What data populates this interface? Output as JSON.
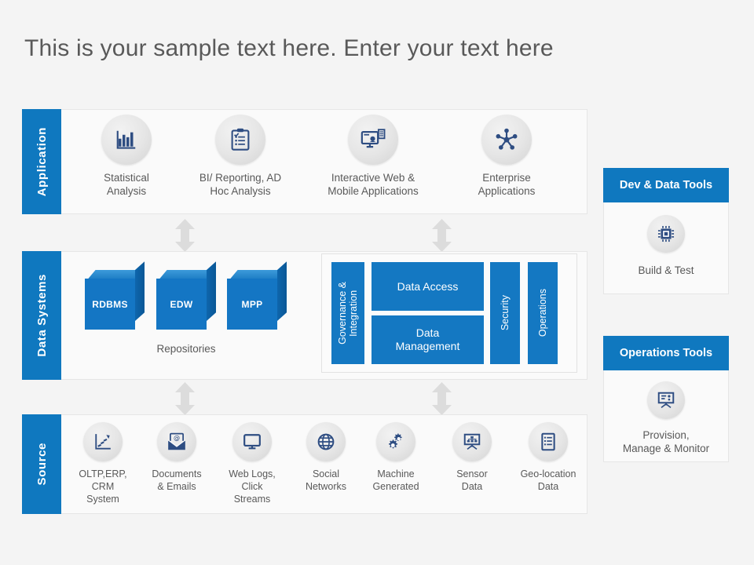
{
  "title": "This is your sample text here. Enter your text here",
  "colors": {
    "accent_blue": "#0f78bf",
    "box_blue": "#1478c2",
    "cube_blue": "#1476c4",
    "background": "#f4f4f4",
    "panel": "#fafafa",
    "text": "#595959",
    "arrow": "#dcdcdc"
  },
  "rows": [
    {
      "tab_label": "Application",
      "items": [
        {
          "label": "Statistical\nAnalysis",
          "icon": "bar-chart-icon"
        },
        {
          "label": "BI/ Reporting, AD\nHoc Analysis",
          "icon": "clipboard-checklist-icon"
        },
        {
          "label": "Interactive Web &\nMobile Applications",
          "icon": "monitor-user-icon"
        },
        {
          "label": "Enterprise\nApplications",
          "icon": "network-hub-icon"
        }
      ]
    },
    {
      "tab_label": "Data Systems",
      "repositories": {
        "caption": "Repositories",
        "cubes": [
          {
            "label": "RDBMS"
          },
          {
            "label": "EDW"
          },
          {
            "label": "MPP"
          }
        ]
      },
      "group": {
        "governance": "Governance &\nIntegration",
        "data_access": "Data Access",
        "data_management": "Data\nManagement",
        "security": "Security",
        "operations": "Operations"
      }
    },
    {
      "tab_label": "Source",
      "items": [
        {
          "label": "OLTP,ERP,\nCRM\nSystem",
          "icon": "trend-chart-icon"
        },
        {
          "label": "Documents\n& Emails",
          "icon": "email-envelope-icon"
        },
        {
          "label": "Web Logs,\nClick\nStreams",
          "icon": "monitor-icon"
        },
        {
          "label": "Social\nNetworks",
          "icon": "globe-icon"
        },
        {
          "label": "Machine\nGenerated",
          "icon": "gears-icon"
        },
        {
          "label": "Sensor\nData",
          "icon": "presentation-board-icon"
        },
        {
          "label": "Geo-location\nData",
          "icon": "list-document-icon"
        }
      ]
    }
  ],
  "tool_panels": [
    {
      "title": "Dev & Data Tools",
      "item": {
        "label": "Build  & Test",
        "icon": "chip-icon"
      }
    },
    {
      "title": "Operations Tools",
      "item": {
        "label": "Provision,\nManage & Monitor",
        "icon": "presentation-board-icon"
      }
    }
  ]
}
